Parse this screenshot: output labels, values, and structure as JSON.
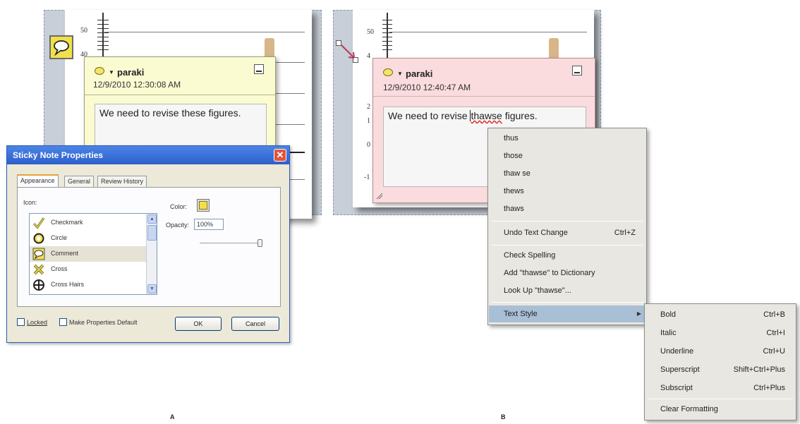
{
  "panel_a": {
    "y_label_50": "50",
    "y_label_40": "40",
    "note": {
      "author": "paraki",
      "date": "12/9/2010 12:30:08 AM",
      "text": "We need to revise these figures."
    },
    "dialog": {
      "title": "Sticky Note Properties",
      "close_glyph": "✕",
      "tabs": [
        "Appearance",
        "General",
        "Review History"
      ],
      "icon_label": "Icon:",
      "icons": [
        {
          "label": "Checkmark",
          "icon": "checkmark-icon"
        },
        {
          "label": "Circle",
          "icon": "circle-icon"
        },
        {
          "label": "Comment",
          "icon": "comment-icon"
        },
        {
          "label": "Cross",
          "icon": "cross-icon"
        },
        {
          "label": "Cross Hairs",
          "icon": "cross-hairs-icon"
        }
      ],
      "selected_icon": "Comment",
      "color_label": "Color:",
      "color_value": "#f1e04a",
      "opacity_label": "Opacity:",
      "opacity_value": "100%",
      "opacity_slider": 1.0,
      "locked_label": "Locked",
      "default_label": "Make Properties Default",
      "ok_label": "OK",
      "cancel_label": "Cancel"
    },
    "caption": "A"
  },
  "panel_b": {
    "y_labels": [
      "50",
      "4",
      "2",
      "1",
      "0",
      "-1"
    ],
    "note": {
      "author": "paraki",
      "date": "12/9/2010 12:40:47 AM",
      "text_before": "We need to revise ",
      "text_misspelled": "thawse",
      "text_after": " figures."
    },
    "context_menu": {
      "suggestions": [
        "thus",
        "those",
        "thaw se",
        "thews",
        "thaws"
      ],
      "undo": {
        "label": "Undo Text Change",
        "shortcut": "Ctrl+Z"
      },
      "check_spelling": "Check Spelling",
      "add_to_dictionary": "Add \"thawse\" to Dictionary",
      "look_up": "Look Up \"thawse\"...",
      "text_style": "Text Style"
    },
    "text_style_menu": [
      {
        "label": "Bold",
        "shortcut": "Ctrl+B"
      },
      {
        "label": "Italic",
        "shortcut": "Ctrl+I"
      },
      {
        "label": "Underline",
        "shortcut": "Ctrl+U"
      },
      {
        "label": "Superscript",
        "shortcut": "Shift+Ctrl+Plus"
      },
      {
        "label": "Subscript",
        "shortcut": "Ctrl+Plus"
      }
    ],
    "clear_formatting": "Clear Formatting",
    "caption": "B"
  }
}
